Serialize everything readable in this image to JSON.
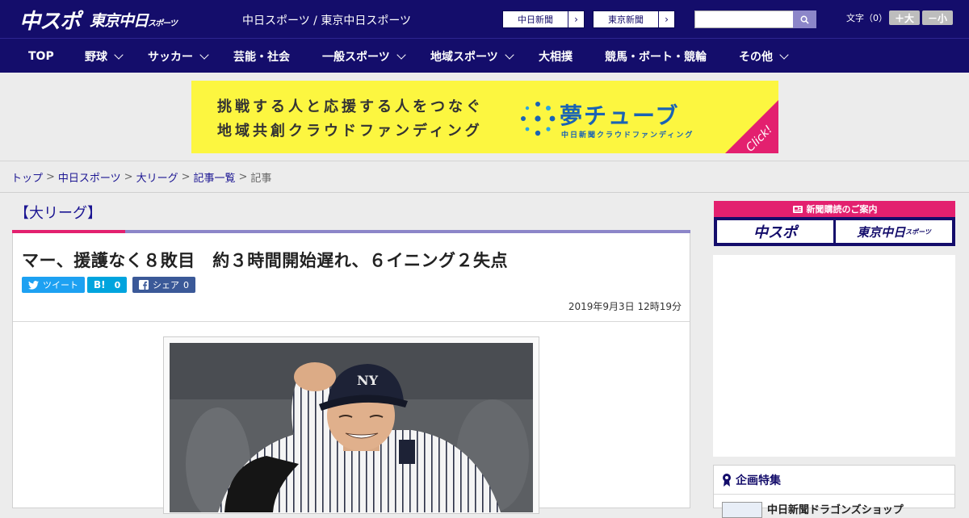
{
  "header": {
    "logo_main": "中スポ",
    "logo_sub": "東京中日",
    "logo_sub_small": "スポーツ",
    "site_title": "中日スポーツ / 東京中日スポーツ",
    "paper_links": [
      {
        "label": "中日新聞"
      },
      {
        "label": "東京新聞"
      }
    ],
    "search_placeholder": "",
    "font_size_label": "文字（0）",
    "font_plus": "＋大",
    "font_minus": "－小"
  },
  "nav": {
    "items": [
      {
        "label": "TOP",
        "has_menu": false
      },
      {
        "label": "野球",
        "has_menu": true
      },
      {
        "label": "サッカー",
        "has_menu": true
      },
      {
        "label": "芸能・社会",
        "has_menu": false
      },
      {
        "label": "一般スポーツ",
        "has_menu": true
      },
      {
        "label": "地域スポーツ",
        "has_menu": true
      },
      {
        "label": "大相撲",
        "has_menu": false
      },
      {
        "label": "競馬・ボート・競輪",
        "has_menu": false
      },
      {
        "label": "その他",
        "has_menu": true
      }
    ]
  },
  "banner": {
    "line1": "挑戦する人と応援する人をつなぐ",
    "line2": "地域共創クラウドファンディング",
    "brand": "夢チューブ",
    "brand_sub": "中日新聞クラウドファンディング",
    "click_label": "Click!",
    "colors": {
      "background": "#fcf640",
      "brand": "#1a63b4",
      "corner": "#e3206f"
    }
  },
  "breadcrumb": {
    "items": [
      "トップ",
      "中日スポーツ",
      "大リーグ",
      "記事一覧"
    ],
    "current": "記事"
  },
  "article": {
    "category": "【大リーグ】",
    "headline": "マー、援護なく８敗目　約３時間開始遅れ、６イニング２失点",
    "share": {
      "tweet_label": "ツイート",
      "hatena_label": "B!",
      "hatena_count": "0",
      "facebook_label": "シェア",
      "facebook_count": "0"
    },
    "date": "2019年9月3日 12時19分"
  },
  "sidebar": {
    "subscription_title": "新聞購読のご案内",
    "subscription_buttons": [
      "中スポ",
      "東京中日"
    ],
    "subscription_button_small": "スポーツ",
    "feature_title": "企画特集",
    "feature_items": [
      "中日新聞ドラゴンズショップ"
    ]
  },
  "colors": {
    "primary": "#140d6b",
    "accent_pink": "#e3206f",
    "accent_purple": "#8c86c9",
    "twitter": "#1da1f2",
    "hatena": "#00a4de",
    "facebook": "#3b5998"
  }
}
